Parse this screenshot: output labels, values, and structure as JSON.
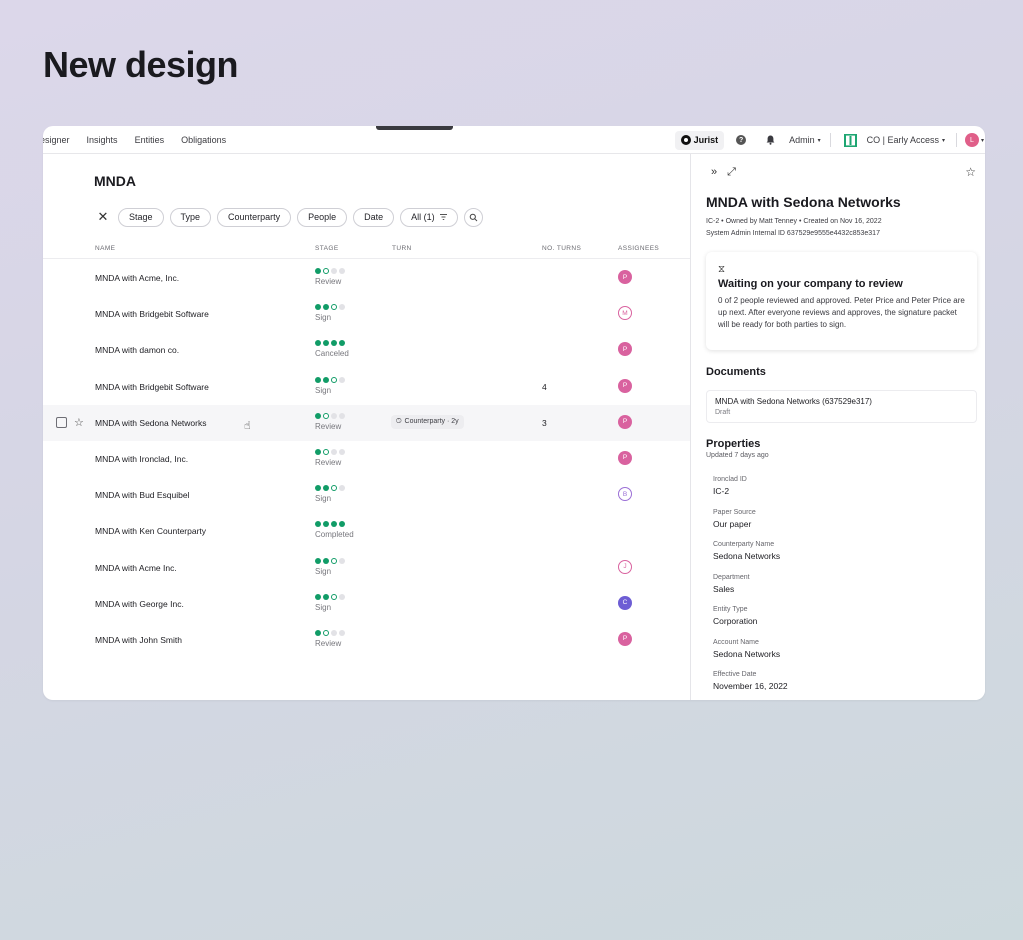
{
  "page": {
    "title": "New design"
  },
  "nav": {
    "links": [
      "esigner",
      "Insights",
      "Entities",
      "Obligations"
    ],
    "jurist_label": "Jurist",
    "admin_label": "Admin",
    "company_label": "CO | Early Access",
    "user_initial": "L"
  },
  "list": {
    "title": "MNDA",
    "filters": [
      "Stage",
      "Type",
      "Counterparty",
      "People",
      "Date",
      "All (1)"
    ],
    "columns": {
      "name": "NAME",
      "stage": "STAGE",
      "turn": "TURN",
      "turns": "NO. TURNS",
      "assignees": "ASSIGNEES"
    },
    "rows": [
      {
        "name": "MNDA with Acme, Inc.",
        "stage": "Review",
        "progress": [
          2,
          1,
          0,
          0
        ],
        "turn": "",
        "turns": "",
        "assignee": "P",
        "avatar_style": "filled-pink"
      },
      {
        "name": "MNDA with Bridgebit Software",
        "stage": "Sign",
        "progress": [
          2,
          2,
          1,
          0
        ],
        "turn": "",
        "turns": "",
        "assignee": "M",
        "avatar_style": "outline-pink"
      },
      {
        "name": "MNDA with damon co.",
        "stage": "Canceled",
        "progress": [
          2,
          2,
          2,
          2
        ],
        "turn": "",
        "turns": "",
        "assignee": "P",
        "avatar_style": "filled-pink"
      },
      {
        "name": "MNDA with Bridgebit Software",
        "stage": "Sign",
        "progress": [
          2,
          2,
          1,
          0
        ],
        "turn": "",
        "turns": "4",
        "assignee": "P",
        "avatar_style": "filled-pink"
      },
      {
        "name": "MNDA with Sedona Networks",
        "stage": "Review",
        "progress": [
          2,
          1,
          0,
          0
        ],
        "turn": "Counterparty · 2y",
        "turns": "3",
        "assignee": "P",
        "avatar_style": "filled-pink",
        "selected": true
      },
      {
        "name": "MNDA with Ironclad, Inc.",
        "stage": "Review",
        "progress": [
          2,
          1,
          0,
          0
        ],
        "turn": "",
        "turns": "",
        "assignee": "P",
        "avatar_style": "filled-pink"
      },
      {
        "name": "MNDA with Bud Esquibel",
        "stage": "Sign",
        "progress": [
          2,
          2,
          1,
          0
        ],
        "turn": "",
        "turns": "",
        "assignee": "B",
        "avatar_style": "outline-purple"
      },
      {
        "name": "MNDA with Ken Counterparty",
        "stage": "Completed",
        "progress": [
          2,
          2,
          2,
          2
        ],
        "turn": "",
        "turns": "",
        "assignee": "",
        "avatar_style": ""
      },
      {
        "name": "MNDA with Acme Inc.",
        "stage": "Sign",
        "progress": [
          2,
          2,
          1,
          0
        ],
        "turn": "",
        "turns": "",
        "assignee": "J",
        "avatar_style": "outline-pink"
      },
      {
        "name": "MNDA with George Inc.",
        "stage": "Sign",
        "progress": [
          2,
          2,
          1,
          0
        ],
        "turn": "",
        "turns": "",
        "assignee": "C",
        "avatar_style": "filled-purple"
      },
      {
        "name": "MNDA with John Smith",
        "stage": "Review",
        "progress": [
          2,
          1,
          0,
          0
        ],
        "turn": "",
        "turns": "",
        "assignee": "P",
        "avatar_style": "filled-pink"
      }
    ]
  },
  "panel": {
    "title": "MNDA with Sedona Networks",
    "meta_line1": "IC-2  •  Owned by Matt Tenney  •  Created on Nov 16, 2022",
    "meta_line2": "System Admin Internal ID 637529e9555e4432c853e317",
    "waiting": {
      "title": "Waiting on your company to review",
      "text": "0 of 2 people reviewed and approved. Peter Price and Peter Price are up next. After everyone reviews and approves, the signature packet will be ready for both parties to sign."
    },
    "documents_title": "Documents",
    "document": {
      "name": "MNDA with Sedona Networks (637529e317)",
      "status": "Draft"
    },
    "properties_title": "Properties",
    "updated": "Updated 7 days ago",
    "properties": [
      {
        "label": "Ironclad ID",
        "value": "IC-2"
      },
      {
        "label": "Paper Source",
        "value": "Our paper"
      },
      {
        "label": "Counterparty Name",
        "value": "Sedona Networks"
      },
      {
        "label": "Department",
        "value": "Sales"
      },
      {
        "label": "Entity Type",
        "value": "Corporation"
      },
      {
        "label": "Account Name",
        "value": "Sedona Networks"
      },
      {
        "label": "Effective Date",
        "value": "November 16, 2022"
      }
    ]
  },
  "colors": {
    "accent_green": "#119c67",
    "avatar_pink": "#d9629f",
    "avatar_purple": "#6d5dd4"
  }
}
